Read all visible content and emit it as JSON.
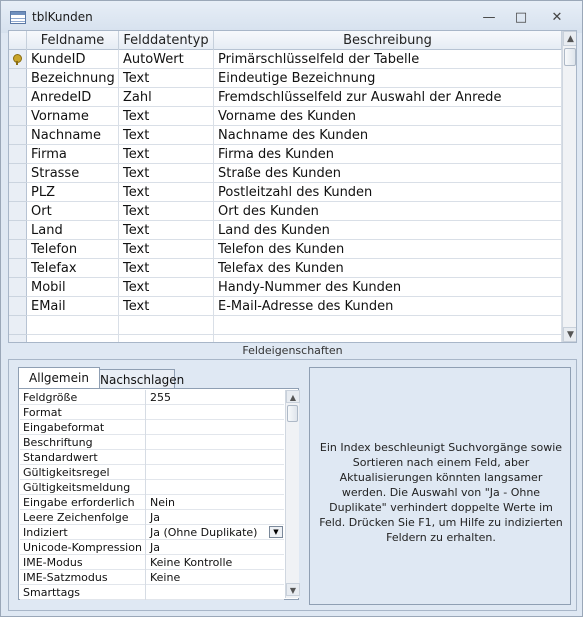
{
  "window": {
    "title": "tblKunden",
    "minimize_glyph": "—",
    "maximize_glyph": "□",
    "close_glyph": "✕"
  },
  "grid": {
    "headers": [
      "Feldname",
      "Felddatentyp",
      "Beschreibung"
    ],
    "rows": [
      {
        "name": "KundeID",
        "type": "AutoWert",
        "desc": "Primärschlüsselfeld der Tabelle",
        "primary_key": true
      },
      {
        "name": "Bezeichnung",
        "type": "Text",
        "desc": "Eindeutige Bezeichnung"
      },
      {
        "name": "AnredeID",
        "type": "Zahl",
        "desc": "Fremdschlüsselfeld zur Auswahl der Anrede"
      },
      {
        "name": "Vorname",
        "type": "Text",
        "desc": "Vorname des Kunden"
      },
      {
        "name": "Nachname",
        "type": "Text",
        "desc": "Nachname des Kunden"
      },
      {
        "name": "Firma",
        "type": "Text",
        "desc": "Firma des Kunden"
      },
      {
        "name": "Strasse",
        "type": "Text",
        "desc": "Straße des Kunden"
      },
      {
        "name": "PLZ",
        "type": "Text",
        "desc": "Postleitzahl des Kunden"
      },
      {
        "name": "Ort",
        "type": "Text",
        "desc": "Ort des Kunden"
      },
      {
        "name": "Land",
        "type": "Text",
        "desc": "Land des Kunden"
      },
      {
        "name": "Telefon",
        "type": "Text",
        "desc": "Telefon des Kunden"
      },
      {
        "name": "Telefax",
        "type": "Text",
        "desc": "Telefax des Kunden"
      },
      {
        "name": "Mobil",
        "type": "Text",
        "desc": "Handy-Nummer des Kunden"
      },
      {
        "name": "EMail",
        "type": "Text",
        "desc": "E-Mail-Adresse des Kunden"
      },
      {
        "name": "",
        "type": "",
        "desc": ""
      },
      {
        "name": "",
        "type": "",
        "desc": ""
      }
    ]
  },
  "section_label": "Feldeigenschaften",
  "tabs": [
    {
      "label": "Allgemein",
      "active": true
    },
    {
      "label": "Nachschlagen",
      "active": false
    }
  ],
  "properties": [
    {
      "name": "Feldgröße",
      "value": "255"
    },
    {
      "name": "Format",
      "value": ""
    },
    {
      "name": "Eingabeformat",
      "value": ""
    },
    {
      "name": "Beschriftung",
      "value": ""
    },
    {
      "name": "Standardwert",
      "value": ""
    },
    {
      "name": "Gültigkeitsregel",
      "value": ""
    },
    {
      "name": "Gültigkeitsmeldung",
      "value": ""
    },
    {
      "name": "Eingabe erforderlich",
      "value": "Nein"
    },
    {
      "name": "Leere Zeichenfolge",
      "value": "Ja"
    },
    {
      "name": "Indiziert",
      "value": "Ja (Ohne Duplikate)",
      "dropdown": true
    },
    {
      "name": "Unicode-Kompression",
      "value": "Ja"
    },
    {
      "name": "IME-Modus",
      "value": "Keine Kontrolle"
    },
    {
      "name": "IME-Satzmodus",
      "value": "Keine"
    },
    {
      "name": "Smarttags",
      "value": ""
    }
  ],
  "help_text": "Ein Index beschleunigt Suchvorgänge sowie Sortieren nach einem Feld, aber Aktualisierungen könnten langsamer werden. Die Auswahl von \"Ja - Ohne Duplikate\" verhindert doppelte Werte im Feld. Drücken Sie F1, um Hilfe zu indizierten Feldern zu erhalten.",
  "icons": {
    "table": "table-icon",
    "key": "primary-key-icon",
    "up": "▲",
    "down": "▼",
    "dropdown": "▼"
  }
}
